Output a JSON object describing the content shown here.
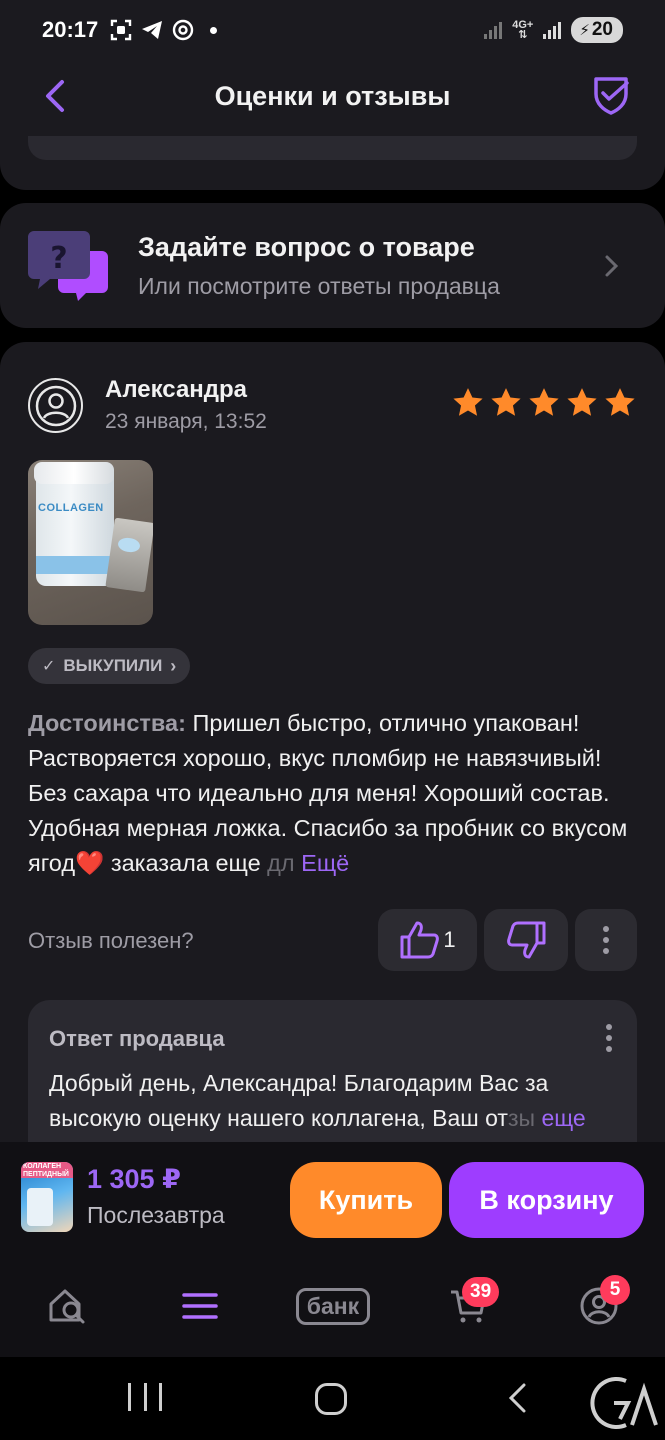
{
  "status_bar": {
    "time": "20:17",
    "icons": [
      "screenshot-icon",
      "telegram-icon",
      "at-icon",
      "dot-icon"
    ],
    "network": "4G+",
    "battery": "20"
  },
  "header": {
    "title": "Оценки и отзывы"
  },
  "question_card": {
    "title": "Задайте вопрос о товаре",
    "subtitle": "Или посмотрите ответы продавца"
  },
  "review": {
    "author": "Александра",
    "date": "23 января, 13:52",
    "rating": 5,
    "rating_max": 5,
    "badge": "ВЫКУПИЛИ",
    "photo_label": "COLLAGEN",
    "text_label": "Достоинства:",
    "text": " Пришел быстро, отлично упакован! Растворяется хорошо, вкус пломбир не навязчивый! Без сахара что идеально для меня! Хороший состав. Удобная мерная ложка. Спасибо за пробник со вкусом ягод",
    "text_emoji": "❤️",
    "text_tail": " заказала еще",
    "text_fade": " дл",
    "more": "Ещё",
    "helpful_label": "Отзыв полезен?",
    "likes": "1"
  },
  "seller_reply": {
    "title": "Ответ продавца",
    "text": "Добрый день, Александра!  Благодарим Вас за высокую оценку нашего коллагена, Ваш от",
    "fade": "зы",
    "more": "еще"
  },
  "buy_bar": {
    "price": "1 305 ₽",
    "delivery": "Послезавтра",
    "thumb_label": "КОЛЛАГЕН ПЕПТИДНЫЙ",
    "buy_label": "Купить",
    "cart_label": "В корзину"
  },
  "tabbar": {
    "bank_label": "банк",
    "cart_count": "39",
    "profile_count": "5"
  },
  "colors": {
    "accent": "#9d67f5",
    "orange": "#ff8a2a",
    "purple": "#9e3dff",
    "star": "#ff8a2a",
    "badge": "#ff3b5c"
  }
}
